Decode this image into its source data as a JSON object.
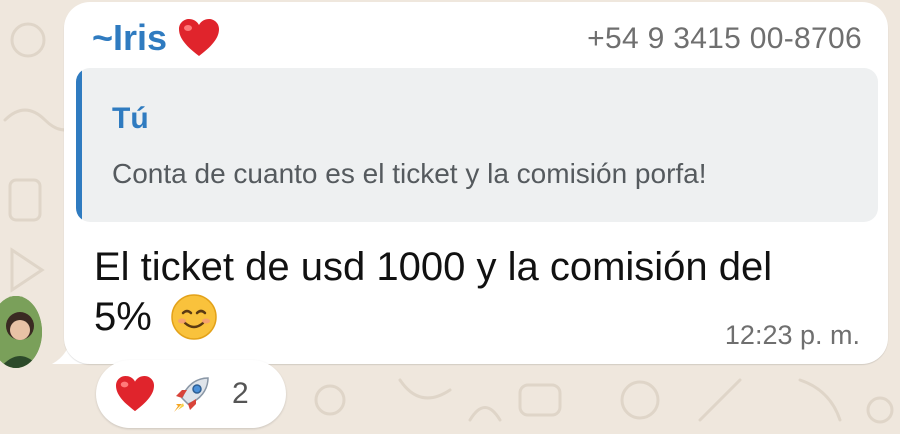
{
  "message": {
    "sender_prefix": "~",
    "sender_name": "Iris",
    "sender_emoji_icon": "red-heart-icon",
    "phone": "+54 9 3415 00-8706",
    "quote": {
      "author": "Tú",
      "text": "Conta de cuanto es el ticket y la comisión porfa!"
    },
    "body_line1": "El ticket de usd 1000 y la comisión del",
    "body_line2": "5%",
    "body_emoji_icon": "smiling-face-icon",
    "time": "12:23 p. m."
  },
  "reactions": {
    "items": [
      "red-heart-icon",
      "rocket-icon"
    ],
    "count": "2"
  },
  "colors": {
    "accent": "#2f7bc0",
    "bubble": "#ffffff",
    "quote_bg": "#eef0f1",
    "wallpaper": "#efe7dd"
  }
}
